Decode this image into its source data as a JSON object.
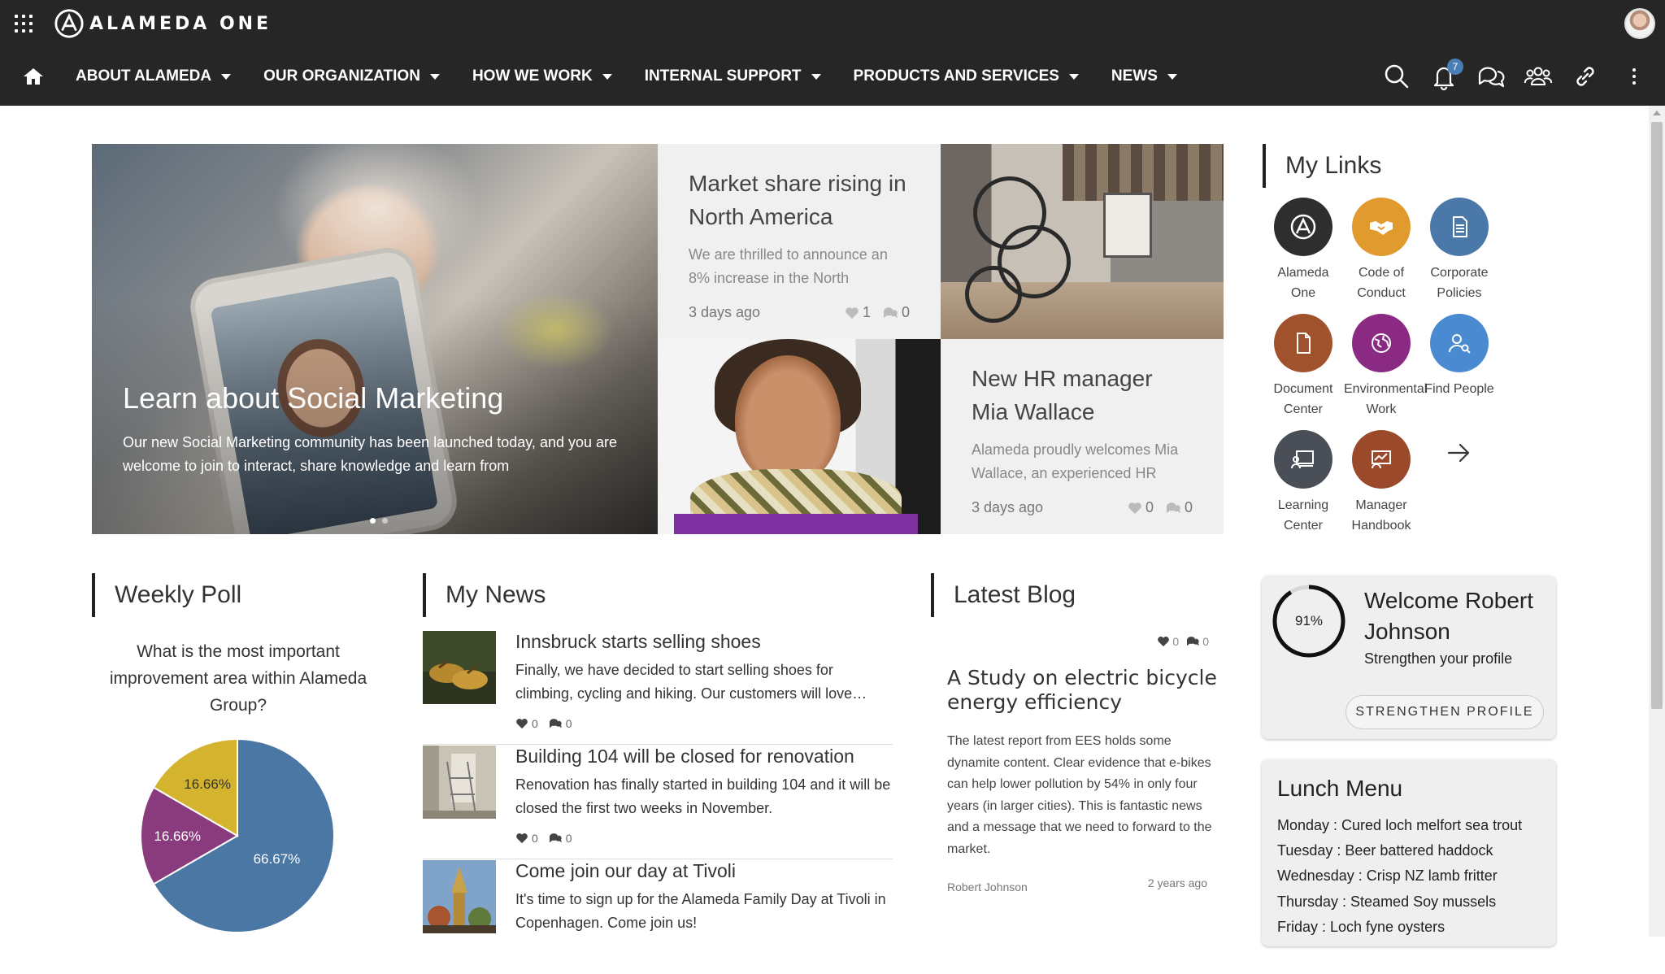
{
  "brand": {
    "name": "ALAMEDA ONE"
  },
  "nav": {
    "items": [
      {
        "label": "ABOUT ALAMEDA"
      },
      {
        "label": "OUR ORGANIZATION"
      },
      {
        "label": "HOW WE WORK"
      },
      {
        "label": "INTERNAL SUPPORT"
      },
      {
        "label": "PRODUCTS AND SERVICES"
      },
      {
        "label": "NEWS"
      }
    ],
    "notification_count": "7"
  },
  "hero": {
    "main": {
      "title": "Learn about Social Marketing",
      "text": "Our new Social Marketing community has been launched today, and you are welcome to join to interact, share knowledge and learn from"
    },
    "tile_a": {
      "title": "Market share rising in North America",
      "text": "We are thrilled to announce an 8% increase in the North",
      "date": "3 days ago",
      "likes": "1",
      "comments": "0"
    },
    "tile_b": {
      "title": "New HR manager Mia Wallace",
      "text": "Alameda proudly welcomes Mia Wallace, an experienced HR",
      "date": "3 days ago",
      "likes": "0",
      "comments": "0"
    }
  },
  "my_links": {
    "title": "My Links",
    "items": [
      {
        "label": "Alameda One",
        "color": "#2e2e2e",
        "icon": "alameda-logo-icon"
      },
      {
        "label": "Code of Conduct",
        "color": "#e09a2e",
        "icon": "handshake-icon"
      },
      {
        "label": "Corporate Policies",
        "color": "#4a78a8",
        "icon": "document-icon"
      },
      {
        "label": "Document Center",
        "color": "#a0522d",
        "icon": "file-icon"
      },
      {
        "label": "Environmental Work",
        "color": "#8a2a82",
        "icon": "globe-icon"
      },
      {
        "label": "Find People",
        "color": "#4a8ad0",
        "icon": "people-search-icon"
      },
      {
        "label": "Learning Center",
        "color": "#4a4f57",
        "icon": "presentation-icon"
      },
      {
        "label": "Manager Handbook",
        "color": "#9a4a2a",
        "icon": "chart-board-icon"
      }
    ]
  },
  "poll": {
    "title": "Weekly Poll",
    "question": "What is the most important improvement area within Alameda Group?",
    "chart_data": {
      "type": "pie",
      "series": [
        {
          "value": 66.67,
          "label": "66.67%",
          "color": "#4b77a5"
        },
        {
          "value": 16.66,
          "label": "16.66%",
          "color": "#8a3b7e"
        },
        {
          "value": 16.66,
          "label": "16.66%",
          "color": "#d4b32e"
        }
      ]
    }
  },
  "my_news": {
    "title": "My News",
    "items": [
      {
        "title": "Innsbruck starts selling shoes",
        "text": "Finally, we have decided to start selling shoes for climbing, cycling and hiking. Our customers will love…",
        "likes": "0",
        "comments": "0"
      },
      {
        "title": "Building 104 will be closed for renovation",
        "text": "Renovation has finally started in building 104 and it will be closed the first two weeks in November.",
        "likes": "0",
        "comments": "0"
      },
      {
        "title": "Come join our day at Tivoli",
        "text": "It's time to sign up for the Alameda Family Day at Tivoli in Copenhagen. Come join us!"
      }
    ]
  },
  "blog": {
    "title": "Latest Blog",
    "likes": "0",
    "comments": "0",
    "post_title": "A Study on electric bicycle energy efficiency",
    "text": "The latest report from EES holds some dynamite content. Clear evidence that e-bikes can help lower pollution by 54% in only four years (in larger cities). This is fantastic news and a message that we need to forward to the market.",
    "author": "Robert Johnson",
    "date": "2 years ago"
  },
  "welcome": {
    "progress_percent": 91,
    "progress_label": "91%",
    "title": "Welcome Robert Johnson",
    "subtitle": "Strengthen your profile",
    "button": "STRENGTHEN PROFILE"
  },
  "lunch": {
    "title": "Lunch Menu",
    "items": [
      "Monday : Cured loch melfort sea trout",
      "Tuesday : Beer battered haddock",
      "Wednesday : Crisp NZ lamb fritter",
      "Thursday : Steamed Soy mussels",
      "Friday : Loch fyne oysters"
    ]
  }
}
